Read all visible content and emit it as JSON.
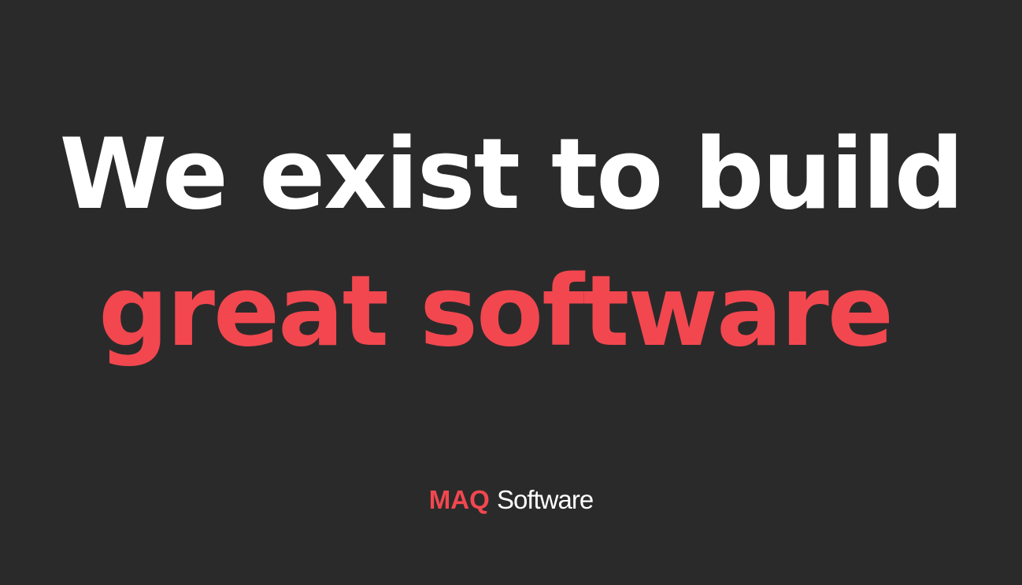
{
  "slide": {
    "headline_line_1": "We exist to build",
    "headline_line_2": "great software"
  },
  "logo": {
    "mark": "MAQ",
    "wordmark": "Software"
  },
  "colors": {
    "background": "#2b2a2a",
    "primary_text": "#ffffff",
    "accent": "#f2474f"
  }
}
